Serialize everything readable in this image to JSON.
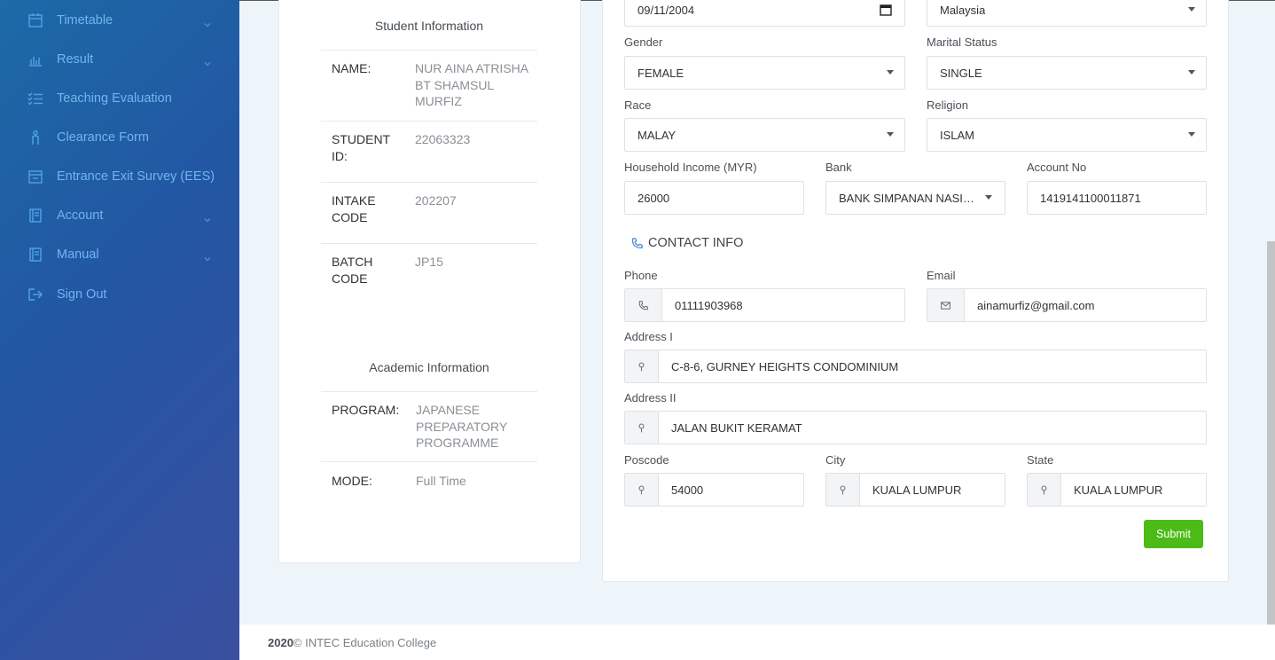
{
  "sidebar": {
    "items": [
      {
        "label": "Timetable",
        "icon": "calendar-icon",
        "has_submenu": true
      },
      {
        "label": "Result",
        "icon": "bar-chart-icon",
        "has_submenu": true
      },
      {
        "label": "Teaching Evaluation",
        "icon": "checklist-icon",
        "has_submenu": false
      },
      {
        "label": "Clearance Form",
        "icon": "person-icon",
        "has_submenu": false
      },
      {
        "label": "Entrance Exit Survey (EES)",
        "icon": "window-icon",
        "has_submenu": false
      },
      {
        "label": "Account",
        "icon": "book-icon",
        "has_submenu": true
      },
      {
        "label": "Manual",
        "icon": "book-icon",
        "has_submenu": true
      },
      {
        "label": "Sign Out",
        "icon": "sign-out-icon",
        "has_submenu": false
      }
    ]
  },
  "student_info": {
    "title": "Student Information",
    "rows": [
      {
        "key": "NAME:",
        "value": "NUR AINA ATRISHA BT SHAMSUL MURFIZ"
      },
      {
        "key": "STUDENT ID:",
        "value": "22063323"
      },
      {
        "key": "INTAKE CODE",
        "value": "202207"
      },
      {
        "key": "BATCH CODE",
        "value": "JP15"
      }
    ]
  },
  "academic_info": {
    "title": "Academic Information",
    "rows": [
      {
        "key": "PROGRAM:",
        "value": "JAPANESE PREPARATORY PROGRAMME"
      },
      {
        "key": "MODE:",
        "value": "Full Time"
      }
    ]
  },
  "form": {
    "date_of_birth": "09/11/2004",
    "nationality": "Malaysia",
    "gender": {
      "label": "Gender",
      "value": "FEMALE"
    },
    "marital_status": {
      "label": "Marital Status",
      "value": "SINGLE"
    },
    "race": {
      "label": "Race",
      "value": "MALAY"
    },
    "religion": {
      "label": "Religion",
      "value": "ISLAM"
    },
    "household_income": {
      "label": "Household Income (MYR)",
      "value": "26000"
    },
    "bank": {
      "label": "Bank",
      "value": "BANK SIMPANAN NASIONAL"
    },
    "account_no": {
      "label": "Account No",
      "value": "1419141100011871"
    },
    "contact_heading": "CONTACT INFO",
    "phone": {
      "label": "Phone",
      "value": "01111903968"
    },
    "email": {
      "label": "Email",
      "value": "ainamurfiz@gmail.com"
    },
    "address1": {
      "label": "Address I",
      "value": "C-8-6, GURNEY HEIGHTS CONDOMINIUM"
    },
    "address2": {
      "label": "Address II",
      "value": "JALAN BUKIT KERAMAT"
    },
    "poscode": {
      "label": "Poscode",
      "value": "54000"
    },
    "city": {
      "label": "City",
      "value": "KUALA LUMPUR"
    },
    "state": {
      "label": "State",
      "value": "KUALA LUMPUR"
    },
    "submit_label": "Submit"
  },
  "footer": {
    "year": "2020",
    "text": "© INTEC Education College"
  },
  "colors": {
    "sidebar_start": "#1c6aa6",
    "sidebar_end": "#3a4fa0",
    "sidebar_text": "#6fb6ee",
    "submit": "#4cbb17"
  }
}
